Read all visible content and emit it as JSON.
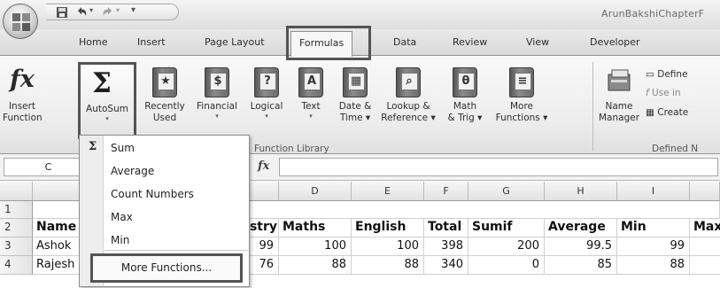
{
  "window": {
    "title": "ArunBakshiChapterF"
  },
  "tabs": [
    "Home",
    "Insert",
    "Page Layout",
    "Formulas",
    "Data",
    "Review",
    "View",
    "Developer"
  ],
  "active_tab": "Formulas",
  "ribbon": {
    "insert_function": {
      "line1": "Insert",
      "line2": "Function",
      "icon": "fx-icon"
    },
    "autosum": {
      "label": "AutoSum",
      "icon": "sigma-icon"
    },
    "recently_used": {
      "line1": "Recently",
      "line2": "Used"
    },
    "financial": {
      "label": "Financial"
    },
    "logical": {
      "label": "Logical",
      "glyph": "?"
    },
    "text": {
      "label": "Text",
      "glyph": "A"
    },
    "date_time": {
      "line1": "Date &",
      "line2": "Time"
    },
    "lookup": {
      "line1": "Lookup &",
      "line2": "Reference"
    },
    "math": {
      "line1": "Math",
      "line2": "& Trig",
      "glyph": "θ"
    },
    "more_functions": {
      "line1": "More",
      "line2": "Functions"
    },
    "function_library_label": "Function Library",
    "name_manager": {
      "line1": "Name",
      "line2": "Manager"
    },
    "define_name": "Define",
    "use_in_formula": "Use in",
    "create": "Create",
    "defined_names_label": "Defined N"
  },
  "formula_bar": {
    "name_box": "C",
    "fx": "fx"
  },
  "columns": [
    "D",
    "E",
    "F",
    "G",
    "H",
    "I"
  ],
  "rows": [
    "1",
    "2",
    "3",
    "4"
  ],
  "sheet": {
    "r2": {
      "a": "Name",
      "c_fragment": "stry",
      "d": "Maths",
      "e": "English",
      "f": "Total",
      "g": "Sumif",
      "h": "Average",
      "i": "Min",
      "j": "Max"
    },
    "r3": {
      "a": "Ashok",
      "c": "99",
      "d": "100",
      "e": "100",
      "f": "398",
      "g": "200",
      "h": "99.5",
      "i": "99"
    },
    "r4": {
      "a": "Rajesh",
      "c": "76",
      "d": "88",
      "e": "88",
      "f": "340",
      "g": "0",
      "h": "85",
      "i": "88"
    }
  },
  "autosum_menu": {
    "items": [
      "Sum",
      "Average",
      "Count Numbers",
      "Max",
      "Min"
    ],
    "more": "More Functions..."
  }
}
